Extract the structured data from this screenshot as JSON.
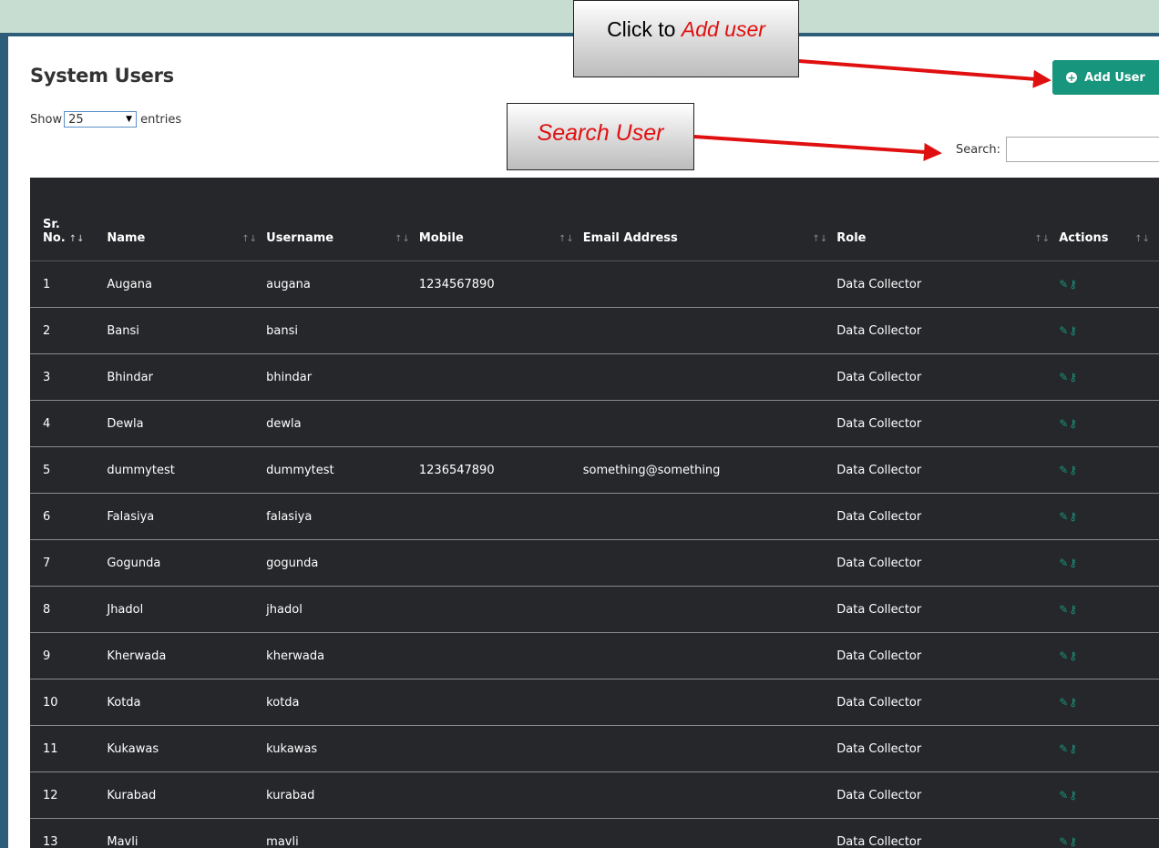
{
  "page": {
    "title": "System Users",
    "add_button_label": "Add User",
    "show_label": "Show",
    "page_length": "25",
    "entries_label": "entries",
    "search_label": "Search:",
    "search_value": ""
  },
  "annotations": {
    "add_prefix": "Click to ",
    "add_emph": "Add user",
    "search_emph": "Search User"
  },
  "table": {
    "headers": [
      {
        "line1": "Sr.",
        "line2": "No.",
        "sort": "↑↓"
      },
      {
        "label": "Name",
        "sort": "↑↓"
      },
      {
        "label": "Username",
        "sort": "↑↓"
      },
      {
        "label": "Mobile",
        "sort": "↑↓"
      },
      {
        "label": "Email Address",
        "sort": "↑↓"
      },
      {
        "label": "Role",
        "sort": "↑↓"
      },
      {
        "label": "Actions",
        "sort": "↑↓"
      }
    ],
    "rows": [
      {
        "no": "1",
        "name": "Augana",
        "username": "augana",
        "mobile": "1234567890",
        "email": "",
        "role": "Data Collector"
      },
      {
        "no": "2",
        "name": "Bansi",
        "username": "bansi",
        "mobile": "",
        "email": "",
        "role": "Data Collector"
      },
      {
        "no": "3",
        "name": "Bhindar",
        "username": "bhindar",
        "mobile": "",
        "email": "",
        "role": "Data Collector"
      },
      {
        "no": "4",
        "name": "Dewla",
        "username": "dewla",
        "mobile": "",
        "email": "",
        "role": "Data Collector"
      },
      {
        "no": "5",
        "name": "dummytest",
        "username": "dummytest",
        "mobile": "1236547890",
        "email": "something@something",
        "role": "Data Collector"
      },
      {
        "no": "6",
        "name": "Falasiya",
        "username": "falasiya",
        "mobile": "",
        "email": "",
        "role": "Data Collector"
      },
      {
        "no": "7",
        "name": "Gogunda",
        "username": "gogunda",
        "mobile": "",
        "email": "",
        "role": "Data Collector"
      },
      {
        "no": "8",
        "name": "Jhadol",
        "username": "jhadol",
        "mobile": "",
        "email": "",
        "role": "Data Collector"
      },
      {
        "no": "9",
        "name": "Kherwada",
        "username": "kherwada",
        "mobile": "",
        "email": "",
        "role": "Data Collector"
      },
      {
        "no": "10",
        "name": "Kotda",
        "username": "kotda",
        "mobile": "",
        "email": "",
        "role": "Data Collector"
      },
      {
        "no": "11",
        "name": "Kukawas",
        "username": "kukawas",
        "mobile": "",
        "email": "",
        "role": "Data Collector"
      },
      {
        "no": "12",
        "name": "Kurabad",
        "username": "kurabad",
        "mobile": "",
        "email": "",
        "role": "Data Collector"
      },
      {
        "no": "13",
        "name": "Mavli",
        "username": "mavli",
        "mobile": "",
        "email": "",
        "role": "Data Collector"
      }
    ]
  },
  "icons": {
    "row_edit": "edit-icon",
    "row_key": "key-icon"
  },
  "colors": {
    "accent": "#17957d",
    "table_bg": "#26272b",
    "annotation_text": "#e01010"
  }
}
